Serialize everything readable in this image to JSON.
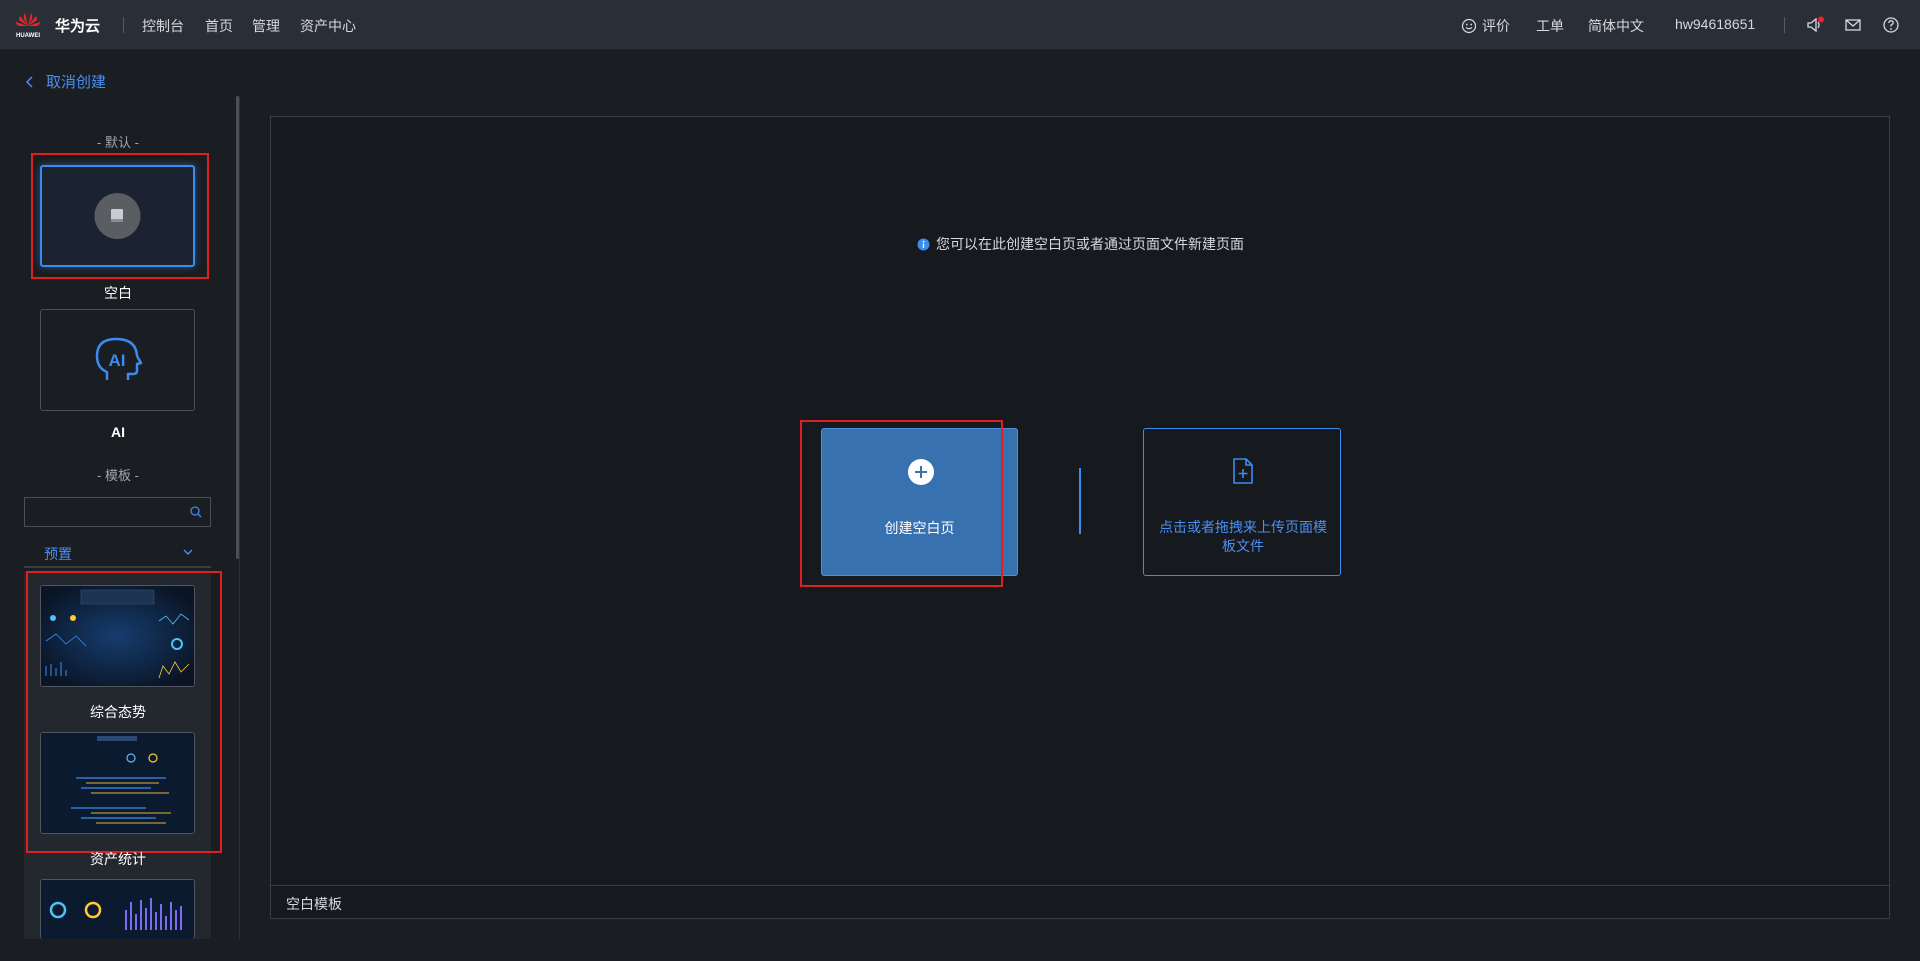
{
  "header": {
    "brand": "华为云",
    "logo_text": "HUAWEI",
    "nav": [
      "控制台",
      "首页",
      "管理",
      "资产中心"
    ],
    "rate_label": "评价",
    "ticket_label": "工单",
    "language": "简体中文",
    "username": "hw94618651"
  },
  "back_label": "取消创建",
  "sidebar": {
    "default_section": "- 默认 -",
    "blank_name": "空白",
    "ai_name": "AI",
    "ai_icon_text": "AI",
    "template_section": "- 模板 -",
    "search_placeholder": "",
    "category": "预置",
    "templates": [
      "综合态势",
      "资产统计"
    ]
  },
  "main": {
    "hint": "您可以在此创建空白页或者通过页面文件新建页面",
    "create_label": "创建空白页",
    "upload_label": "点击或者拖拽来上传页面模板文件",
    "footer_label": "空白模板"
  },
  "colors": {
    "accent": "#3b8cf0",
    "create_bg": "#3871b0",
    "highlight": "#e02020",
    "notification_dot": "#f5222d"
  }
}
